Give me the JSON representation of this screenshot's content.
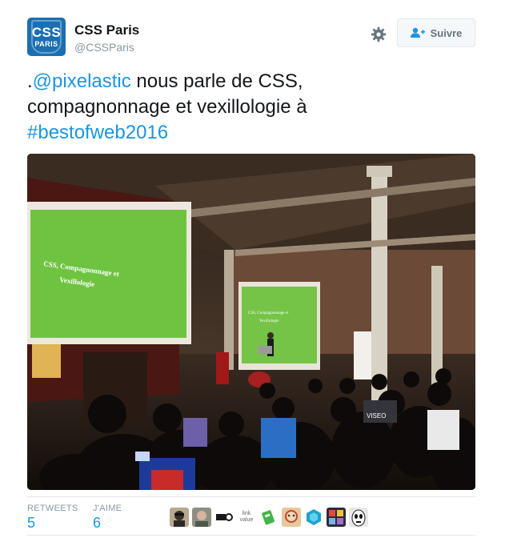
{
  "account": {
    "name": "CSS Paris",
    "handle": "@CSSParis",
    "avatar_line1": "CSS",
    "avatar_line2": "PARIS"
  },
  "actions": {
    "settings_icon": "gear-icon",
    "follow_label": "Suivre",
    "follow_icon": "add-user-icon"
  },
  "tweet": {
    "prefix": ".",
    "mention": "@pixelastic",
    "text_1": " nous parle de CSS,",
    "text_2": "compagnonnage et vexillologie à",
    "hashtag": "#bestofweb2016"
  },
  "photo": {
    "slide_line1": "CSS, Compagnonnage et",
    "slide_line2": "Vexillologie",
    "small_slide_line1": "CSS, Compagnonnage et",
    "small_slide_line2": "Vexillologie",
    "shirt_text": "VISEO"
  },
  "stats": {
    "retweets_label": "RETWEETS",
    "retweets_value": "5",
    "likes_label": "J'AIME",
    "likes_value": "6"
  },
  "likers": [
    {
      "name": "liker-avatar-1",
      "bg": "#b9a98f"
    },
    {
      "name": "liker-avatar-2",
      "bg": "#8d8f83"
    },
    {
      "name": "liker-avatar-3",
      "bg": "#ffffff"
    },
    {
      "name": "liker-avatar-4",
      "bg": "#ffffff",
      "text": "link value"
    },
    {
      "name": "liker-avatar-5",
      "bg": "#ffffff"
    },
    {
      "name": "liker-avatar-6",
      "bg": "#e7c89b"
    },
    {
      "name": "liker-avatar-7",
      "bg": "#ffffff"
    },
    {
      "name": "liker-avatar-8",
      "bg": "#2b2b3a"
    },
    {
      "name": "liker-avatar-9",
      "bg": "#e8e8e8"
    }
  ],
  "colors": {
    "link": "#1b95e0",
    "muted": "#8899a6",
    "avatar_bg": "#1b6fb0",
    "border": "#e1e8ed"
  }
}
